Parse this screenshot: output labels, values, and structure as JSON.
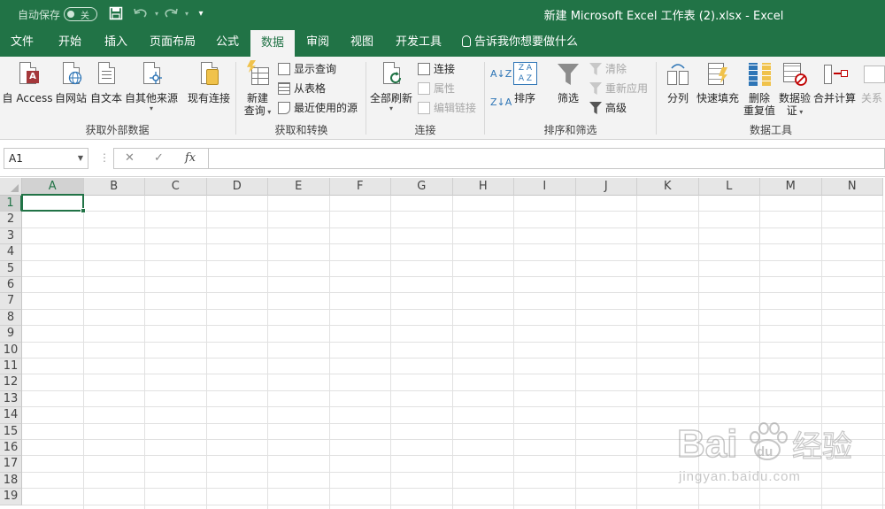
{
  "titlebar": {
    "autosave_label": "自动保存",
    "autosave_state": "关",
    "doc_title": "新建 Microsoft Excel 工作表 (2).xlsx  -  Excel"
  },
  "tabs": [
    {
      "label": "文件"
    },
    {
      "label": "开始"
    },
    {
      "label": "插入"
    },
    {
      "label": "页面布局"
    },
    {
      "label": "公式"
    },
    {
      "label": "数据"
    },
    {
      "label": "审阅"
    },
    {
      "label": "视图"
    },
    {
      "label": "开发工具"
    }
  ],
  "tell_me": "告诉我你想要做什么",
  "ribbon": {
    "external": {
      "group_label": "获取外部数据",
      "access": "自 Access",
      "web": "自网站",
      "text": "自文本",
      "other": "自其他来源",
      "existing": "现有连接"
    },
    "transform": {
      "group_label": "获取和转换",
      "new_query_1": "新建",
      "new_query_2": "查询",
      "show_queries": "显示查询",
      "from_table": "从表格",
      "recent_sources": "最近使用的源"
    },
    "connections": {
      "group_label": "连接",
      "refresh_all": "全部刷新",
      "connections": "连接",
      "properties": "属性",
      "edit_links": "编辑链接"
    },
    "sort_filter": {
      "group_label": "排序和筛选",
      "sort": "排序",
      "filter": "筛选",
      "clear": "清除",
      "reapply": "重新应用",
      "advanced": "高级"
    },
    "data_tools": {
      "group_label": "数据工具",
      "text_to_columns": "分列",
      "flash_fill": "快速填充",
      "remove_dup_1": "删除",
      "remove_dup_2": "重复值",
      "validation_1": "数据验",
      "validation_2": "证",
      "consolidate": "合并计算",
      "relationships": "关系"
    }
  },
  "formula_bar": {
    "name_box": "A1",
    "cancel": "✕",
    "enter": "✓",
    "fx": "fx",
    "value": ""
  },
  "grid": {
    "columns": [
      "A",
      "B",
      "C",
      "D",
      "E",
      "F",
      "G",
      "H",
      "I",
      "J",
      "K",
      "L",
      "M",
      "N"
    ],
    "rows": [
      "1",
      "2",
      "3",
      "4",
      "5",
      "6",
      "7",
      "8",
      "9",
      "10",
      "11",
      "12",
      "13",
      "14",
      "15",
      "16",
      "17",
      "18",
      "19"
    ],
    "selected_cell": "A1"
  },
  "watermark": {
    "brand": "Bai",
    "brand_du": "du",
    "cn": "经验",
    "url": "jingyan.baidu.com"
  }
}
